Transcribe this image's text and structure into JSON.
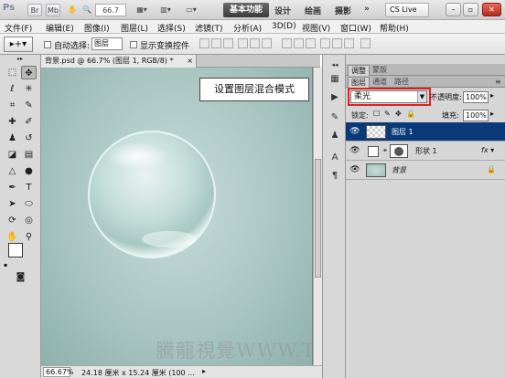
{
  "titlebar": {
    "logo": "Ps",
    "zoom": "66.7",
    "workspaces": [
      "基本功能",
      "设计",
      "绘画",
      "摄影"
    ],
    "cs_live": "CS Live"
  },
  "menu": [
    "文件(F)",
    "编辑(E)",
    "图像(I)",
    "图层(L)",
    "选择(S)",
    "滤镜(T)",
    "分析(A)",
    "3D(D)",
    "视图(V)",
    "窗口(W)",
    "帮助(H)"
  ],
  "options": {
    "auto_select_label": "自动选择:",
    "auto_select_value": "图层",
    "show_transform_label": "显示变换控件"
  },
  "document": {
    "tab_title": "背景.psd @ 66.7% (图层 1, RGB/8) *",
    "zoom": "66.67%",
    "doc_size": "24.18 厘米 x 15.24 厘米 (100 ...",
    "callout": "设置图层混合模式",
    "watermark": "騰龍視覺WWW.TLVI.NET"
  },
  "adjust_tabs": [
    "调整",
    "蒙版"
  ],
  "layers_panel": {
    "tabs": [
      "图层",
      "通道",
      "路径"
    ],
    "blend_mode": "柔光",
    "opacity_label": "不透明度:",
    "opacity": "100%",
    "lock_label": "锁定:",
    "fill_label": "填充:",
    "fill": "100%",
    "layers": [
      {
        "name": "图层 1",
        "selected": true
      },
      {
        "name": "形状 1",
        "selected": false
      },
      {
        "name": "背景",
        "selected": false
      }
    ]
  }
}
